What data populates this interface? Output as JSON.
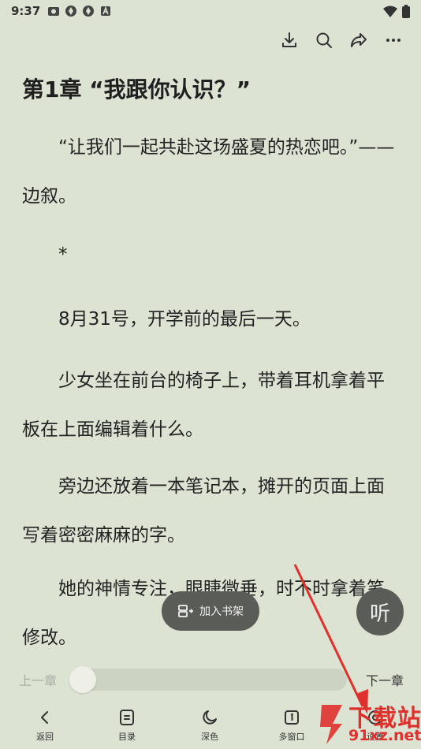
{
  "status_bar": {
    "time": "9:37"
  },
  "toolbar": {
    "icons": [
      "download-icon",
      "search-icon",
      "share-icon",
      "more-icon"
    ]
  },
  "chapter": {
    "title": "第1章 “我跟你认识？”",
    "paragraphs": [
      "　　“让我们一起共赴这场盛夏的热恋吧。”——边叙。",
      "　　*",
      "　　8月31号，开学前的最后一天。",
      "　　少女坐在前台的椅子上，带着耳机拿着平板在上面编辑着什么。",
      "　　旁边还放着一本笔记本，摊开的页面上面写着密密麻麻的字。",
      "　　她的神情专注，眼睫微垂，时不时拿着笔修改。"
    ]
  },
  "floating": {
    "add_shelf_label": "加入书架",
    "listen_label": "听"
  },
  "progress": {
    "prev_label": "上一章",
    "next_label": "下一章",
    "position": 0.0
  },
  "bottom_nav": [
    {
      "label": "返回",
      "icon": "back-icon"
    },
    {
      "label": "目录",
      "icon": "catalog-icon"
    },
    {
      "label": "深色",
      "icon": "moon-icon"
    },
    {
      "label": "多窗口",
      "icon": "multi-window-icon"
    },
    {
      "label": "设置",
      "icon": "settings-icon"
    }
  ],
  "watermark": {
    "text": "下载站",
    "url": "91xz.net"
  },
  "colors": {
    "background": "#dde3d3",
    "floating_button": "#5a5c58",
    "annotation_arrow": "#e0302c"
  }
}
